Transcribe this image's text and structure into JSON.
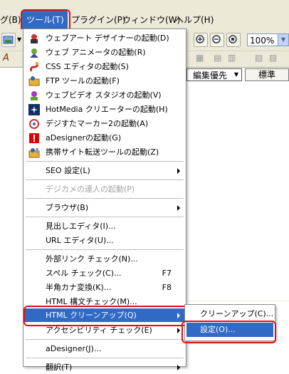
{
  "menubar": {
    "items": [
      {
        "label": "グ(B)"
      },
      {
        "label": "ツール(T)"
      },
      {
        "label": "プラグイン(P)"
      },
      {
        "label": "ウィンドウ(W)"
      },
      {
        "label": "ヘルプ(H)"
      }
    ]
  },
  "toolbar": {
    "zoom_value": "100%",
    "mode_select": "編集優先",
    "style_select": "標準"
  },
  "menu": {
    "items": [
      {
        "label": "ウェブアート デザイナーの起動(D)",
        "icon": "webart-designer-icon"
      },
      {
        "label": "ウェブ アニメータの起動(R)",
        "icon": "web-animator-icon"
      },
      {
        "label": "CSS エディタの起動(S)",
        "icon": "css-editor-icon"
      },
      {
        "label": "FTP ツールの起動(F)",
        "icon": "ftp-tool-icon"
      },
      {
        "label": "ウェブビデオ スタジオの起動(V)",
        "icon": "web-video-studio-icon"
      },
      {
        "label": "HotMedia クリエーターの起動(H)",
        "icon": "hotmedia-icon"
      },
      {
        "label": "デジすたマーカー2の起動(A)",
        "icon": "digista-marker-icon"
      },
      {
        "label": "aDesignerの起動(G)",
        "icon": "adesigner-icon"
      },
      {
        "label": "携帯サイト転送ツールの起動(Z)",
        "icon": "mobile-transfer-icon"
      },
      {
        "label": "SEO 設定(L)"
      },
      {
        "label": "デジカメの達人の起動(P)"
      },
      {
        "label": "ブラウザ(B)"
      },
      {
        "label": "見出しエディタ(I)..."
      },
      {
        "label": "URL エディタ(U)..."
      },
      {
        "label": "外部リンク チェック(N)..."
      },
      {
        "label": "スペル チェック(C)...",
        "accel": "F7"
      },
      {
        "label": "半角カナ変換(K)...",
        "accel": "F8"
      },
      {
        "label": "HTML 構文チェック(M)..."
      },
      {
        "label": "HTML クリーンアップ(Q)"
      },
      {
        "label": "アクセシビリティ チェック(E)"
      },
      {
        "label": "aDesigner(J)..."
      },
      {
        "label": "翻訳(T)"
      }
    ]
  },
  "submenu": {
    "items": [
      {
        "label": "クリーンアップ(C)..."
      },
      {
        "label": "設定(O)..."
      }
    ]
  },
  "colors": {
    "highlight": "#316ac5",
    "annotation_ring": "#e01010"
  }
}
